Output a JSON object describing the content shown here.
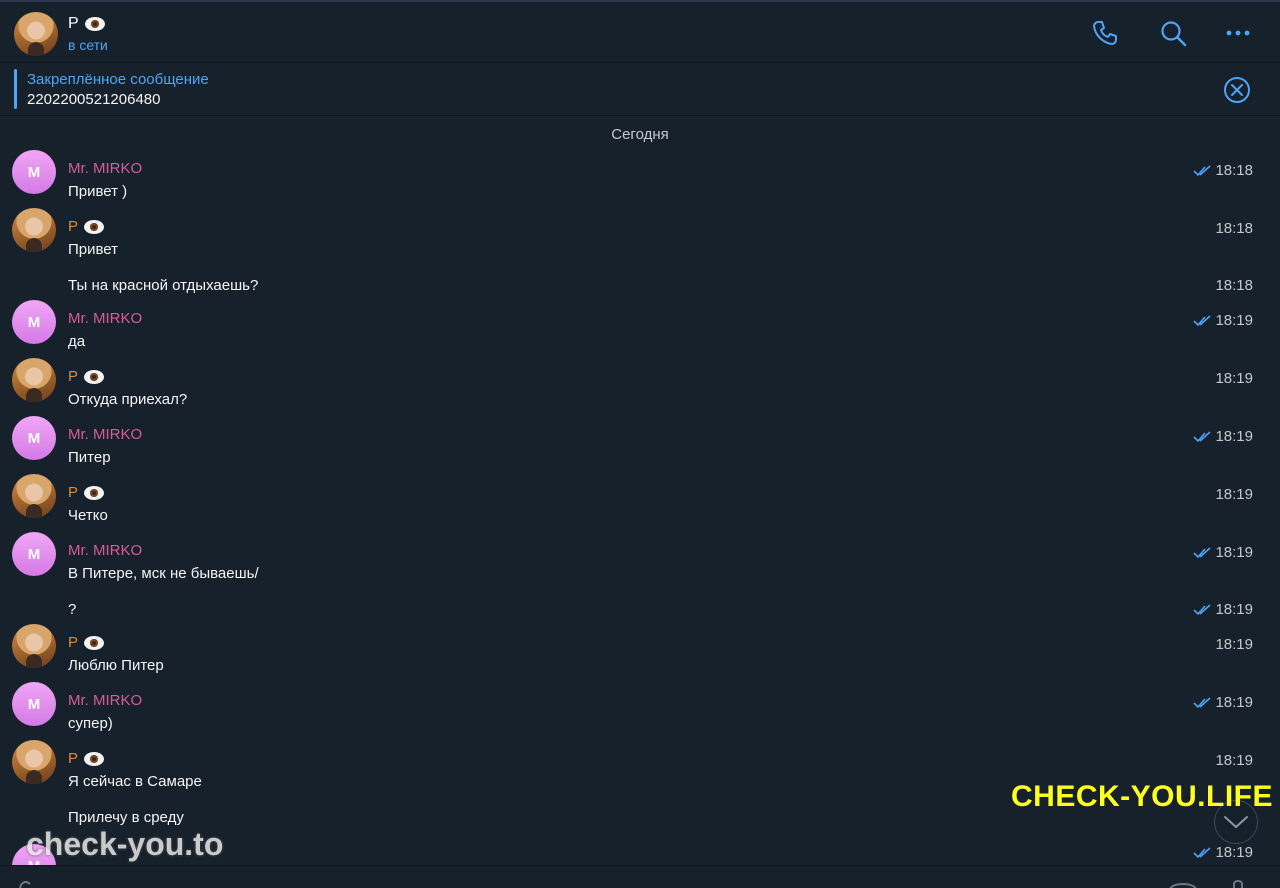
{
  "header": {
    "name": "P",
    "status": "в сети",
    "icons": [
      "phone-icon",
      "search-icon",
      "more-icon"
    ]
  },
  "pinned": {
    "title": "Закреплённое сообщение",
    "text": "2202200521206480"
  },
  "date_separator": "Сегодня",
  "messages": [
    {
      "sender": "Mr. MIRKO",
      "text": "Привет )",
      "time": "18:18",
      "read": true
    },
    {
      "sender": "P",
      "text": "Привет",
      "time": "18:18",
      "read": false
    },
    {
      "sender": "",
      "text": "Ты на красной отдыхаешь?",
      "time": "18:18",
      "read": false
    },
    {
      "sender": "Mr. MIRKO",
      "text": "да",
      "time": "18:19",
      "read": true
    },
    {
      "sender": "P",
      "text": "Откуда приехал?",
      "time": "18:19",
      "read": false
    },
    {
      "sender": "Mr. MIRKO",
      "text": "Питер",
      "time": "18:19",
      "read": true
    },
    {
      "sender": "P",
      "text": "Четко",
      "time": "18:19",
      "read": false
    },
    {
      "sender": "Mr. MIRKO",
      "text": "В Питере, мск не бываешь/",
      "time": "18:19",
      "read": true
    },
    {
      "sender": "",
      "text": "?",
      "time": "18:19",
      "read": true
    },
    {
      "sender": "P",
      "text": "Люблю Питер",
      "time": "18:19",
      "read": false
    },
    {
      "sender": "Mr. MIRKO",
      "text": "супер)",
      "time": "18:19",
      "read": true
    },
    {
      "sender": "P",
      "text": "Я сейчас в Самаре",
      "time": "18:19",
      "read": false
    },
    {
      "sender": "",
      "text": "Прилечу в среду",
      "time": "",
      "read": false
    },
    {
      "sender": "Mr. MIRKO",
      "text": "",
      "time": "18:19",
      "read": true
    }
  ],
  "avatar_letter": "M",
  "watermarks": {
    "right": "CHECK-YOU.LIFE",
    "left": "check-you.to"
  },
  "colors": {
    "background": "#17212b",
    "accent": "#4ea4f6",
    "mirko_name": "#d65d9b",
    "p_name": "#e1883a",
    "watermark_right": "#ffff1f"
  }
}
